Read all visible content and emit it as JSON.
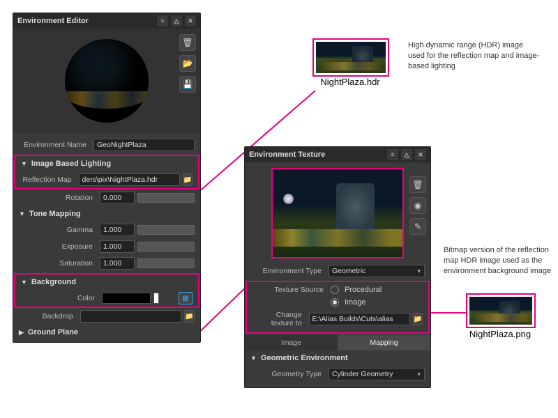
{
  "env_editor": {
    "title": "Environment Editor",
    "env_name_label": "Environment Name",
    "env_name_value": "GeoNightPlaza",
    "sections": {
      "ibl": {
        "title": "Image Based Lighting",
        "reflection_map_label": "Reflection Map",
        "reflection_map_value": "ders\\pix\\NightPlaza.hdr",
        "rotation_label": "Rotation",
        "rotation_value": "0.000"
      },
      "tone_mapping": {
        "title": "Tone Mapping",
        "gamma_label": "Gamma",
        "gamma_value": "1.000",
        "exposure_label": "Exposure",
        "exposure_value": "1.000",
        "saturation_label": "Saturation",
        "saturation_value": "1.000"
      },
      "background": {
        "title": "Background",
        "color_label": "Color",
        "backdrop_label": "Backdrop"
      },
      "ground_plane": {
        "title": "Ground Plane"
      }
    }
  },
  "env_texture": {
    "title": "Environment Texture",
    "env_type_label": "Environment Type",
    "env_type_value": "Geometric",
    "texture_source_label": "Texture Source",
    "procedural_label": "Procedural",
    "image_label": "Image",
    "change_texture_label": "Change texture to",
    "change_texture_value": "E:\\Alias Builds\\Cuts\\alias",
    "tab_image": "Image",
    "tab_mapping": "Mapping",
    "geo_env_title": "Geometric Environment",
    "geo_type_label": "Geometry Type",
    "geo_type_value": "Cylinder Geometry"
  },
  "callouts": {
    "hdr_filename": "NightPlaza.hdr",
    "hdr_caption": "High dynamic range (HDR) image used for the reflection map and image-based lighting",
    "png_filename": "NightPlaza.png",
    "png_caption": "Bitmap version of the reflection map HDR image used as the environment background image"
  }
}
